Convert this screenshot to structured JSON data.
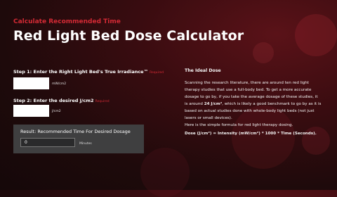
{
  "header": {
    "eyebrow": "Calculate Recommended Time",
    "title": "Red Light Bed Dose Calculator"
  },
  "step1": {
    "label": "Step 1: Enter the Right Light Bed's True Irradiance™",
    "required": "Required",
    "value": "",
    "unit": "mW/cm2"
  },
  "step2": {
    "label": "Step 2: Enter the desired J/cm2",
    "required": "Required",
    "value": "",
    "unit": "J/cm2"
  },
  "result": {
    "label": "Result: Recommended Time For Desired Dosage",
    "value": "0",
    "unit": "Minutes"
  },
  "info": {
    "title": "The Ideal Dose",
    "lines": [
      "Scanning the research literature, there are around ten red light",
      "therapy studies that use a full-body bed. To get a more accurate",
      "dosage to go by, if you take the average dosage of these studies, it",
      "is around ",
      "24 J/cm²",
      ", which is likely a good benchmark to go by as it is",
      "based on actual studies done with whole-body light beds (not just",
      "lasers or small devices).",
      "Here is the simple formula for red light therapy dosing."
    ],
    "formula": "Dose (J/cm²) = Intensity (mW/cm²) * 1000 * Time (Seconds)."
  },
  "colors": {
    "accent": "#d42a35",
    "panel": "#3f3f40"
  }
}
